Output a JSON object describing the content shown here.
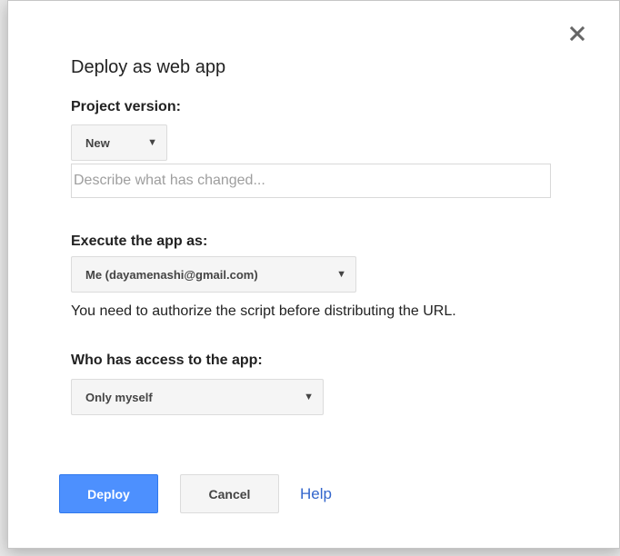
{
  "dialog": {
    "title": "Deploy as web app",
    "close_icon": "close-icon"
  },
  "project_version": {
    "label": "Project version:",
    "selected": "New",
    "description_placeholder": "Describe what has changed...",
    "description_value": ""
  },
  "execute_as": {
    "label": "Execute the app as:",
    "selected": "Me (dayamenashi@gmail.com)",
    "note": "You need to authorize the script before distributing the URL."
  },
  "access": {
    "label": "Who has access to the app:",
    "selected": "Only myself"
  },
  "buttons": {
    "deploy": "Deploy",
    "cancel": "Cancel",
    "help": "Help"
  },
  "colors": {
    "primary_button": "#4d90fe",
    "link": "#3366cc"
  }
}
